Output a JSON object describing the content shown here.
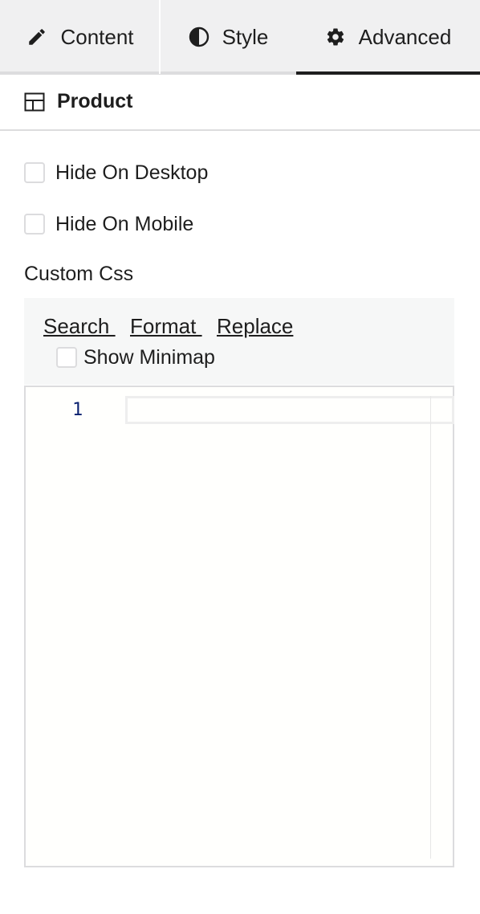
{
  "tabs": [
    {
      "label": "Content",
      "icon": "pencil-icon",
      "active": false
    },
    {
      "label": "Style",
      "icon": "half-circle-icon",
      "active": false
    },
    {
      "label": "Advanced",
      "icon": "gear-icon",
      "active": true
    }
  ],
  "widget": {
    "label": "Product",
    "icon": "table-layout-icon"
  },
  "options": {
    "hide_desktop": {
      "label": "Hide On Desktop",
      "checked": false
    },
    "hide_mobile": {
      "label": "Hide On Mobile",
      "checked": false
    }
  },
  "custom_css": {
    "label": "Custom Css",
    "toolbar": {
      "search": "Search ",
      "format": "Format ",
      "replace": "Replace",
      "minimap_label": "Show Minimap",
      "minimap_checked": false
    },
    "editor": {
      "line_number": "1",
      "content": ""
    }
  },
  "colors": {
    "active_tab_underline": "#1e1e1e",
    "tab_bg": "#f0f0f1",
    "line_number": "#0b216f"
  }
}
